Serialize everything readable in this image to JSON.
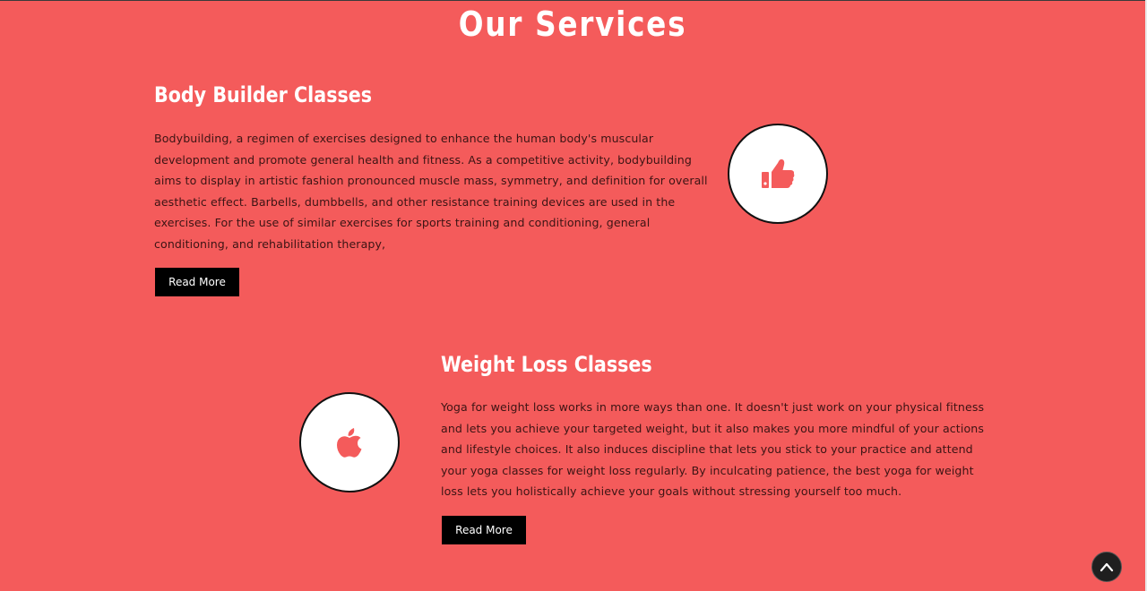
{
  "page": {
    "title": "Our Services"
  },
  "services": [
    {
      "title": "Body Builder Classes",
      "text": "Bodybuilding, a regimen of exercises designed to enhance the human body's muscular development and promote general health and fitness. As a competitive activity, bodybuilding aims to display in artistic fashion pronounced muscle mass, symmetry, and definition for overall aesthetic effect. Barbells, dumbbells, and other resistance training devices are used in the exercises. For the use of similar exercises for sports training and conditioning, general conditioning, and rehabilitation therapy,",
      "button_label": "Read More",
      "icon": "thumbs-up-icon"
    },
    {
      "title": "Weight Loss Classes",
      "text": "Yoga for weight loss works in more ways than one. It doesn't just work on your physical fitness and lets you achieve your targeted weight, but it also makes you more mindful of your actions and lifestyle choices. It also induces discipline that lets you stick to your practice and attend your yoga classes for weight loss regularly. By inculcating patience, the best yoga for weight loss lets you holistically achieve your goals without stressing yourself too much.",
      "button_label": "Read More",
      "icon": "apple-icon"
    }
  ],
  "scroll_top": {
    "icon": "chevron-up-icon"
  },
  "colors": {
    "background": "#f45b5b",
    "accent": "#f45b5b",
    "button": "#000000",
    "text": "#3c1414"
  }
}
